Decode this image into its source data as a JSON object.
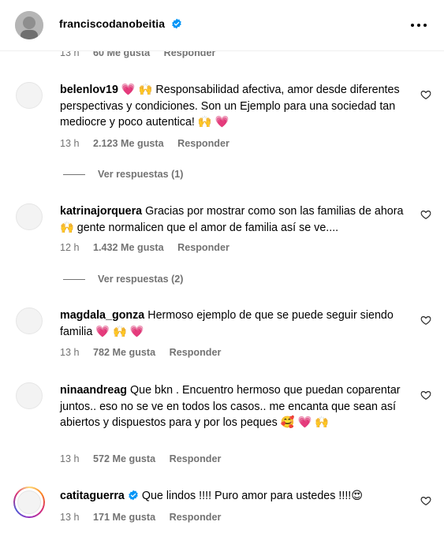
{
  "post": {
    "author_username": "franciscodanobeitia",
    "author_verified": true,
    "more_icon": "more-horizontal-icon"
  },
  "partial_comment": {
    "time": "13 h",
    "likes": "60 Me gusta",
    "reply": "Responder"
  },
  "comments": [
    {
      "username": "belenlov19",
      "text": "💗 🙌 Responsabilidad afectiva, amor desde diferentes perspectivas y condiciones. Son un Ejemplo para una sociedad tan mediocre y poco autentica! 🙌 💗",
      "time": "13 h",
      "likes": "2.123 Me gusta",
      "reply": "Responder",
      "view_replies": "Ver respuestas (1)"
    },
    {
      "username": "katrinajorquera",
      "text": "Gracias por mostrar como son las familias de ahora 🙌 gente normalicen que el amor de familia así se ve....",
      "time": "12 h",
      "likes": "1.432 Me gusta",
      "reply": "Responder",
      "view_replies": "Ver respuestas (2)"
    },
    {
      "username": "magdala_gonza",
      "text": "Hermoso ejemplo de que se puede seguir siendo familia 💗 🙌 💗",
      "time": "13 h",
      "likes": "782 Me gusta",
      "reply": "Responder"
    },
    {
      "username": "ninaandreag",
      "text": "Que bkn . Encuentro hermoso que puedan coparentar juntos.. eso no se ve en todos los casos.. me encanta que sean así abiertos y dispuestos para y por los peques 🥰 💗 🙌",
      "time": "13 h",
      "likes": "572 Me gusta",
      "reply": "Responder"
    },
    {
      "username": "catitaguerra",
      "verified": true,
      "text": "Que lindos !!!! Puro amor para ustedes !!!!😍",
      "time": "13 h",
      "likes": "171 Me gusta",
      "reply": "Responder"
    }
  ],
  "icons": {
    "like": "heart-outline-icon",
    "verified": "verified-badge-icon"
  },
  "colors": {
    "verified_blue": "#0095f6",
    "secondary_text": "#737373",
    "heart_red": "#ed4956"
  }
}
